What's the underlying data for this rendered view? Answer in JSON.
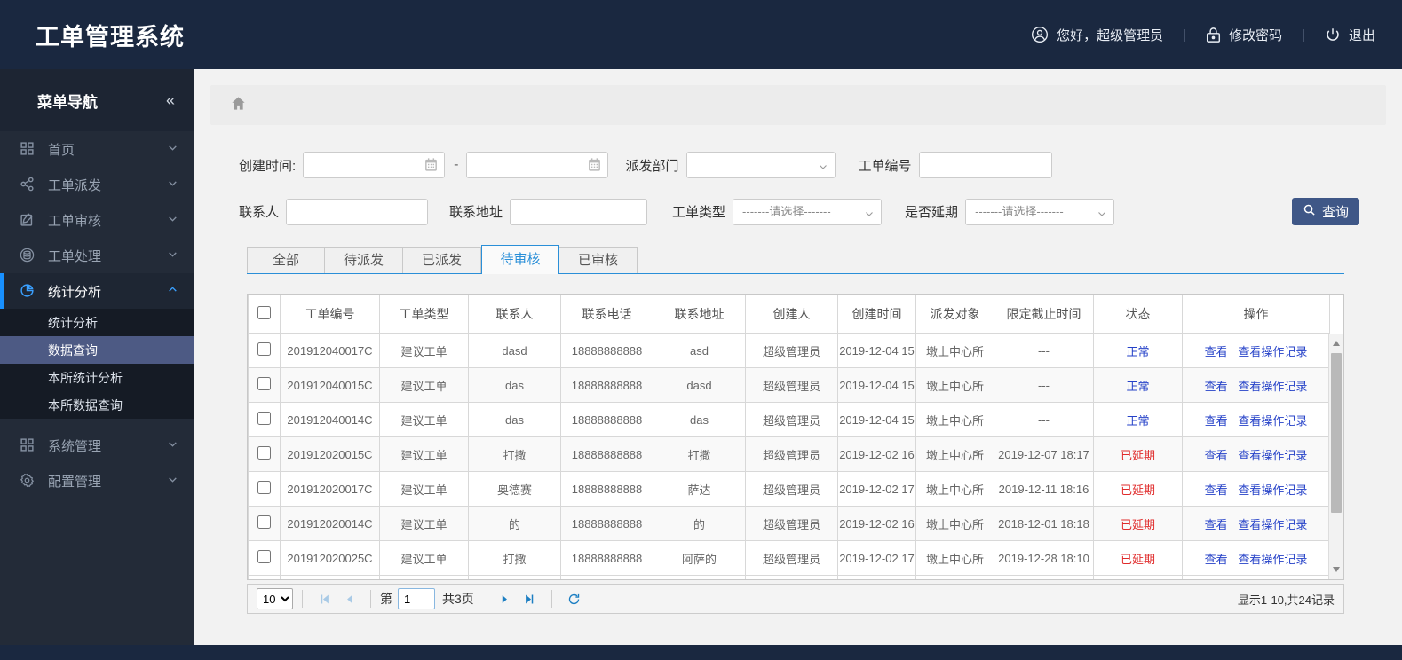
{
  "header": {
    "title": "工单管理系统",
    "greeting": "您好，超级管理员",
    "change_password": "修改密码",
    "logout": "退出",
    "separator": "|"
  },
  "sidebar": {
    "title": "菜单导航",
    "collapse_icon": "«",
    "items": [
      {
        "label": "首页",
        "icon": "grid-icon"
      },
      {
        "label": "工单派发",
        "icon": "share-icon"
      },
      {
        "label": "工单审核",
        "icon": "edit-icon"
      },
      {
        "label": "工单处理",
        "icon": "layers-icon"
      },
      {
        "label": "统计分析",
        "icon": "pie-chart-icon",
        "active": true,
        "expanded": true
      },
      {
        "label": "系统管理",
        "icon": "grid-icon"
      },
      {
        "label": "配置管理",
        "icon": "gear-icon"
      }
    ],
    "submenu": [
      {
        "label": "统计分析",
        "selected": false
      },
      {
        "label": "数据查询",
        "selected": true
      },
      {
        "label": "本所统计分析",
        "selected": false
      },
      {
        "label": "本所数据查询",
        "selected": false
      }
    ]
  },
  "filters": {
    "create_time_label": "创建时间:",
    "date_separator": "-",
    "depart_label": "派发部门",
    "order_no_label": "工单编号",
    "contact_label": "联系人",
    "address_label": "联系地址",
    "order_type_label": "工单类型",
    "delay_label": "是否延期",
    "select_placeholder": "-------请选择-------",
    "search_button": "查询"
  },
  "tabs": [
    {
      "label": "全部",
      "active": false
    },
    {
      "label": "待派发",
      "active": false
    },
    {
      "label": "已派发",
      "active": false
    },
    {
      "label": "待审核",
      "active": true
    },
    {
      "label": "已审核",
      "active": false
    }
  ],
  "table": {
    "columns": [
      "工单编号",
      "工单类型",
      "联系人",
      "联系电话",
      "联系地址",
      "创建人",
      "创建时间",
      "派发对象",
      "限定截止时间",
      "状态",
      "操作"
    ],
    "action_view": "查看",
    "action_log": "查看操作记录",
    "rows": [
      {
        "order_no": "201912040017C",
        "type": "建议工单",
        "contact": "dasd",
        "phone": "18888888888",
        "address": "asd",
        "creator": "超级管理员",
        "created": "2019-12-04 15",
        "target": "墩上中心所",
        "deadline": "---",
        "status": "正常",
        "status_type": "normal"
      },
      {
        "order_no": "201912040015C",
        "type": "建议工单",
        "contact": "das",
        "phone": "18888888888",
        "address": "dasd",
        "creator": "超级管理员",
        "created": "2019-12-04 15",
        "target": "墩上中心所",
        "deadline": "---",
        "status": "正常",
        "status_type": "normal"
      },
      {
        "order_no": "201912040014C",
        "type": "建议工单",
        "contact": "das",
        "phone": "18888888888",
        "address": "das",
        "creator": "超级管理员",
        "created": "2019-12-04 15",
        "target": "墩上中心所",
        "deadline": "---",
        "status": "正常",
        "status_type": "normal"
      },
      {
        "order_no": "201912020015C",
        "type": "建议工单",
        "contact": "打撒",
        "phone": "18888888888",
        "address": "打撒",
        "creator": "超级管理员",
        "created": "2019-12-02 16",
        "target": "墩上中心所",
        "deadline": "2019-12-07 18:17",
        "status": "已延期",
        "status_type": "delayed"
      },
      {
        "order_no": "201912020017C",
        "type": "建议工单",
        "contact": "奥德赛",
        "phone": "18888888888",
        "address": "萨达",
        "creator": "超级管理员",
        "created": "2019-12-02 17",
        "target": "墩上中心所",
        "deadline": "2019-12-11 18:16",
        "status": "已延期",
        "status_type": "delayed"
      },
      {
        "order_no": "201912020014C",
        "type": "建议工单",
        "contact": "的",
        "phone": "18888888888",
        "address": "的",
        "creator": "超级管理员",
        "created": "2019-12-02 16",
        "target": "墩上中心所",
        "deadline": "2018-12-01 18:18",
        "status": "已延期",
        "status_type": "delayed"
      },
      {
        "order_no": "201912020025C",
        "type": "建议工单",
        "contact": "打撒",
        "phone": "18888888888",
        "address": "阿萨的",
        "creator": "超级管理员",
        "created": "2019-12-02 17",
        "target": "墩上中心所",
        "deadline": "2019-12-28 18:10",
        "status": "已延期",
        "status_type": "delayed"
      }
    ]
  },
  "pagination": {
    "page_size": "10",
    "page_prefix": "第",
    "current_page": "1",
    "total_pages": "共3页",
    "summary": "显示1-10,共24记录"
  },
  "colors": {
    "header_bg": "#1a2840",
    "sidebar_bg": "#232b38",
    "submenu_selected_bg": "#4d5a84",
    "active_border_blue": "#1890ff",
    "tab_active_blue": "#2a8fd8",
    "link_blue": "#2642c8",
    "status_normal": "#2642c8",
    "status_delayed": "#e02b2b",
    "search_button_bg": "#3f5787",
    "pager_arrow_blue": "#1b7ec2"
  }
}
